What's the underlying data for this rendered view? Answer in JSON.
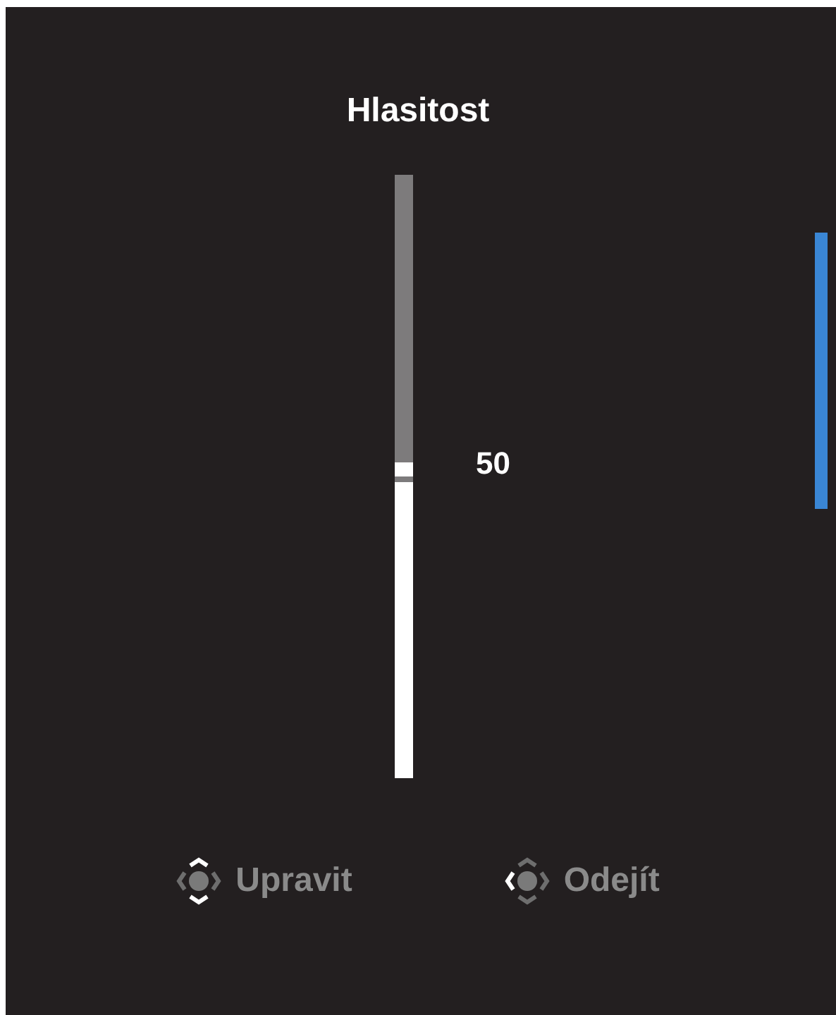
{
  "title": "Hlasitost",
  "slider": {
    "level": 0.49,
    "reading": "50"
  },
  "hints": [
    {
      "kind": "up-down",
      "label": "Upravit"
    },
    {
      "kind": "left",
      "label": "Odejít"
    }
  ]
}
